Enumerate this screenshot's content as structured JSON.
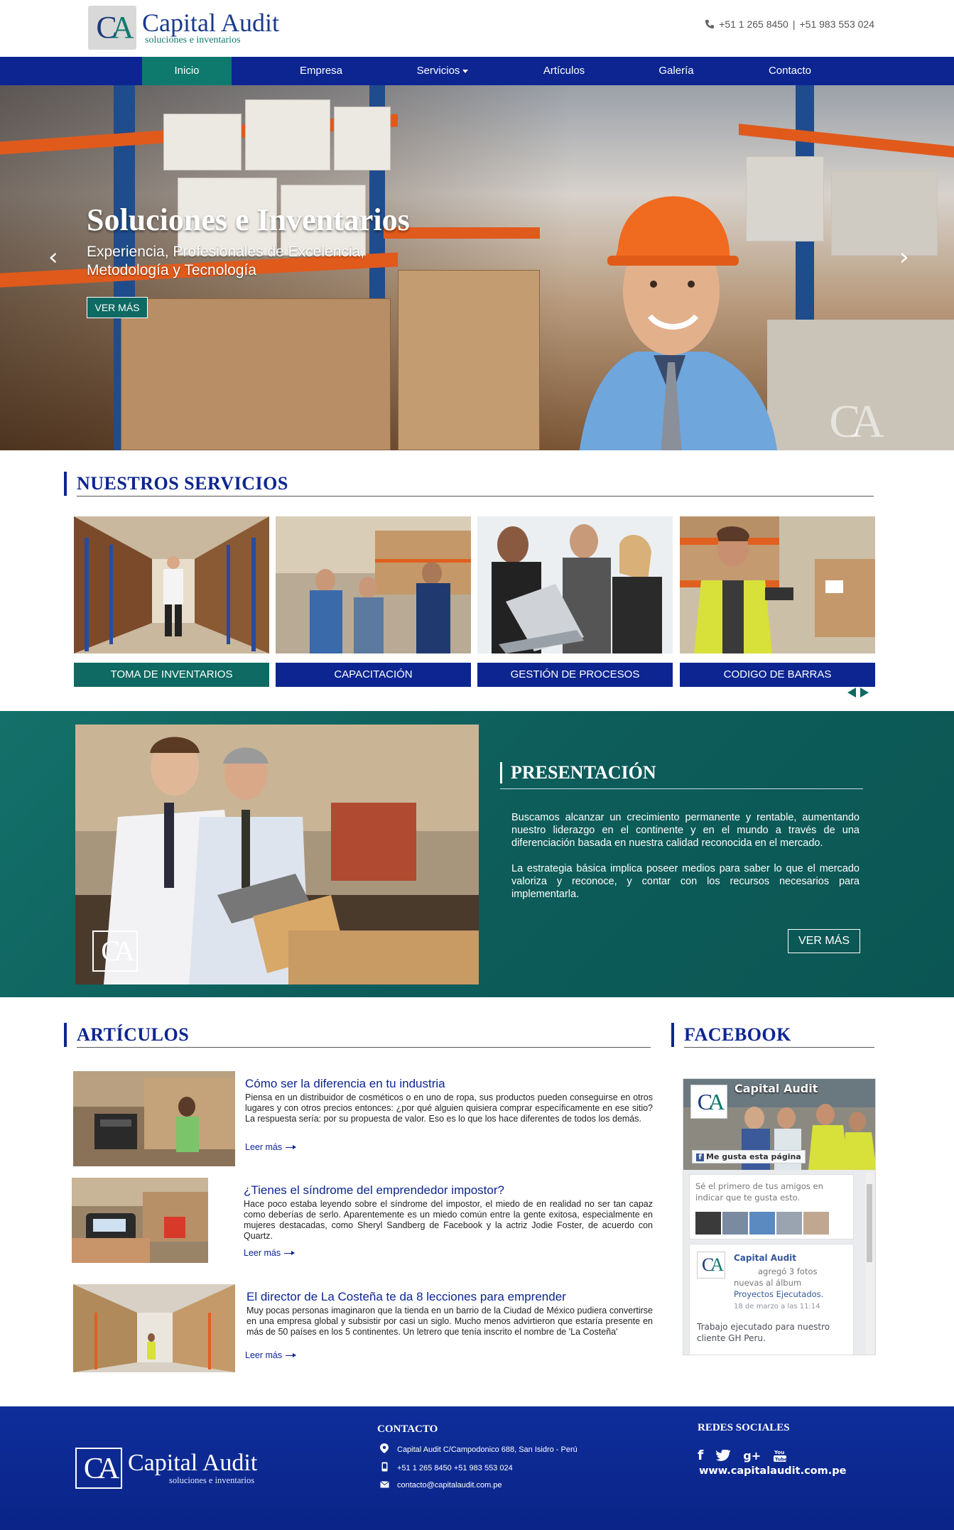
{
  "brand": {
    "name": "Capital Audit",
    "tagline": "soluciones e inventarios",
    "mark": "CA"
  },
  "header": {
    "phone1": "+51 1 265 8450",
    "separator": "|",
    "phone2": "+51 983 553 024"
  },
  "nav": {
    "items": [
      {
        "label": "Inicio",
        "active": true
      },
      {
        "label": "Empresa"
      },
      {
        "label": "Servicios",
        "dropdown": true
      },
      {
        "label": "Artículos"
      },
      {
        "label": "Galería"
      },
      {
        "label": "Contacto"
      }
    ]
  },
  "hero": {
    "title": "Soluciones e Inventarios",
    "subtitle_line1": "Experiencia, Profesionales de Excelencia,",
    "subtitle_line2": "Metodología y Tecnología",
    "button": "VER MÁS",
    "prev": "‹",
    "next": "›",
    "watermark": "CA"
  },
  "services": {
    "heading": "NUESTROS SERVICIOS",
    "items": [
      {
        "label": "TOMA DE INVENTARIOS",
        "color": "#0e6a62"
      },
      {
        "label": "CAPACITACIÓN",
        "color": "#0c2591"
      },
      {
        "label": "GESTIÓN DE PROCESOS",
        "color": "#0c2591"
      },
      {
        "label": "CODIGO DE BARRAS",
        "color": "#0c2591"
      }
    ]
  },
  "presentation": {
    "heading": "PRESENTACIÓN",
    "p1": "Buscamos alcanzar un crecimiento permanente y rentable, aumentando nuestro liderazgo en el continente y en el mundo a través de una diferenciación basada en nuestra calidad reconocida en el mercado.",
    "p2": "La estrategia básica implica poseer medios para saber lo que el mercado valoriza y reconoce, y contar con los recursos necesarios para implementarla.",
    "button": "VER MÁS",
    "watermark": "CA"
  },
  "articles": {
    "heading": "ARTÍCULOS",
    "more_label": "Leer más",
    "items": [
      {
        "title": "Cómo ser la diferencia en tu industria",
        "text": "Piensa en un distribuidor de cosméticos o en uno de ropa, sus productos pueden conseguirse en otros lugares y con otros precios entonces: ¿por qué alguien quisiera comprar específicamente en ese sitio?La respuesta sería: por su propuesta de valor. Eso es lo que los hace diferentes de todos los demás."
      },
      {
        "title": "¿Tienes el síndrome del emprendedor impostor?",
        "text": "Hace poco estaba leyendo sobre el síndrome del impostor, el miedo de en realidad no ser tan capaz como deberías de serlo. Aparentemente es un miedo común entre la gente exitosa, especialmente en mujeres destacadas, como Sheryl Sandberg de Facebook y la actriz Jodie Foster, de acuerdo con Quartz."
      },
      {
        "title": "El director de La Costeña te da 8 lecciones para emprender",
        "text": "Muy pocas personas imaginaron que la tienda en un barrio de la Ciudad de México pudiera convertirse en una empresa global y subsistir por casi un siglo. Mucho menos advirtieron que estaría presente en más de 50 países en los 5 continentes. Un letrero que tenía inscrito el nombre de 'La Costeña'"
      }
    ]
  },
  "facebook": {
    "heading": "FACEBOOK",
    "page_name": "Capital Audit",
    "like_label": "Me gusta esta página",
    "friends_text": "Sé el primero de tus amigos en indicar que te gusta esto.",
    "post_author": "Capital Audit",
    "post_meta1": "agregó 3 fotos",
    "post_meta2": "nuevas al álbum",
    "post_album": "Proyectos Ejecutados.",
    "post_date": "18 de marzo a las 11:14",
    "post_text": "Trabajo ejecutado para nuestro cliente GH Peru."
  },
  "footer": {
    "contact_heading": "CONTACTO",
    "address": "Capital Audit  C/Campodonico 688, San Isidro - Perú",
    "phones": "+51 1 265 8450   +51 983 553 024",
    "email": "contacto@capitalaudit.com.pe",
    "social_heading": "REDES SOCIALES",
    "social_icons": [
      "facebook-icon",
      "twitter-icon",
      "google-plus-icon",
      "youtube-icon"
    ],
    "url": "www.capitalaudit.com.pe"
  }
}
